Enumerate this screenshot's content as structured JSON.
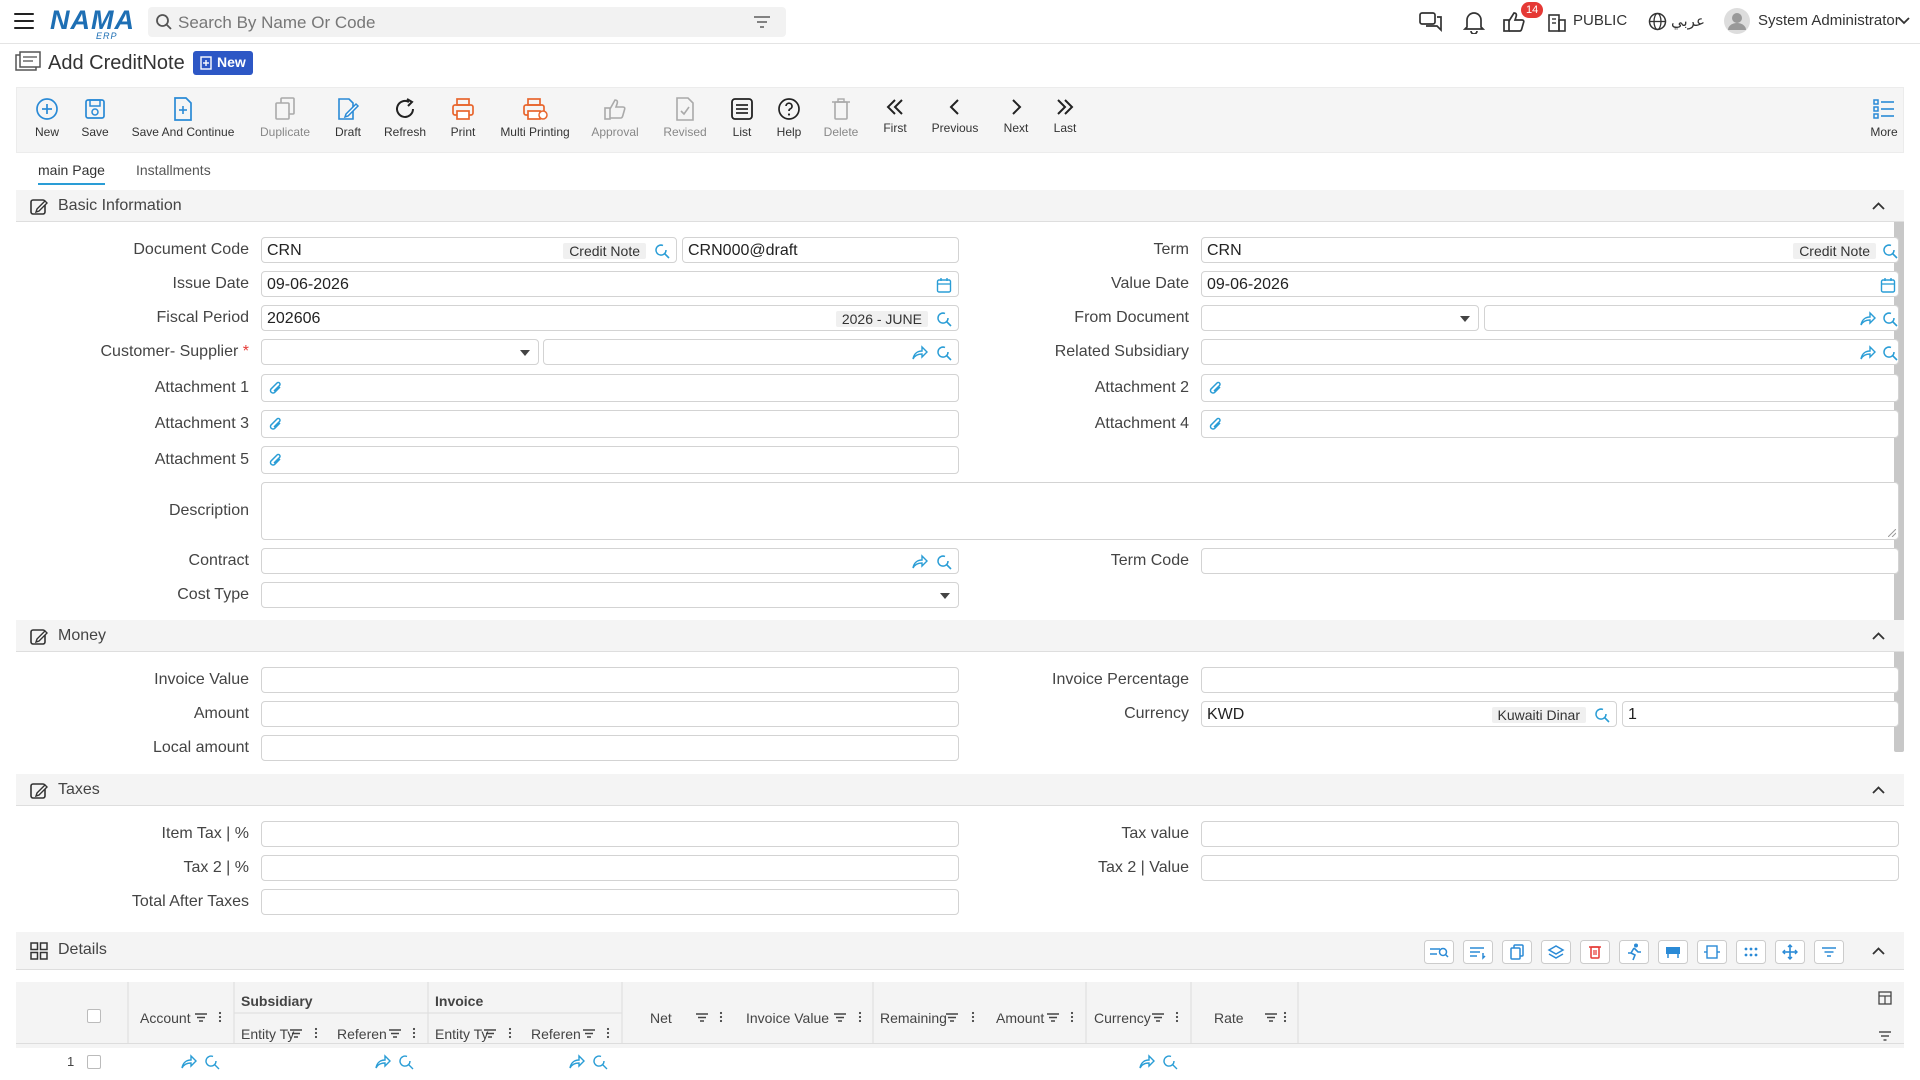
{
  "header": {
    "logo_text": "NAMA",
    "logo_sub": "ERP",
    "search_placeholder": "Search By Name Or Code",
    "notification_count": "14",
    "company": "PUBLIC",
    "language": "عربي",
    "user": "System Administrator"
  },
  "page": {
    "title": "Add CreditNote",
    "status_badge": "New"
  },
  "toolbar": {
    "new": "New",
    "save": "Save",
    "save_continue": "Save And Continue",
    "duplicate": "Duplicate",
    "draft": "Draft",
    "refresh": "Refresh",
    "print": "Print",
    "multi_printing": "Multi Printing",
    "approval": "Approval",
    "revised": "Revised",
    "list": "List",
    "help": "Help",
    "delete": "Delete",
    "first": "First",
    "previous": "Previous",
    "next": "Next",
    "last": "Last",
    "more": "More"
  },
  "tabs": {
    "main": "main Page",
    "installments": "Installments"
  },
  "sections": {
    "basic": "Basic Information",
    "money": "Money",
    "taxes": "Taxes",
    "details": "Details"
  },
  "basic": {
    "document_code_label": "Document Code",
    "document_code": "CRN",
    "document_code_tag": "Credit Note",
    "document_number": "CRN000@draft",
    "term_label": "Term",
    "term": "CRN",
    "term_tag": "Credit Note",
    "issue_date_label": "Issue Date",
    "issue_date": "09-06-2026",
    "value_date_label": "Value Date",
    "value_date": "09-06-2026",
    "fiscal_period_label": "Fiscal Period",
    "fiscal_period": "202606",
    "fiscal_period_tag": "2026 - JUNE",
    "from_document_label": "From Document",
    "customer_supplier_label": "Customer- Supplier",
    "required_mark": "*",
    "related_subsidiary_label": "Related Subsidiary",
    "attachment1_label": "Attachment 1",
    "attachment2_label": "Attachment 2",
    "attachment3_label": "Attachment 3",
    "attachment4_label": "Attachment 4",
    "attachment5_label": "Attachment 5",
    "description_label": "Description",
    "contract_label": "Contract",
    "term_code_label": "Term Code",
    "cost_type_label": "Cost Type"
  },
  "money": {
    "invoice_value_label": "Invoice Value",
    "invoice_percentage_label": "Invoice Percentage",
    "amount_label": "Amount",
    "currency_label": "Currency",
    "currency": "KWD",
    "currency_tag": "Kuwaiti Dinar",
    "rate": "1",
    "local_amount_label": "Local amount"
  },
  "taxes": {
    "item_tax_label": "Item Tax | %",
    "tax_value_label": "Tax value",
    "tax2_label": "Tax 2 | %",
    "tax2_value_label": "Tax 2 | Value",
    "total_after_taxes_label": "Total After Taxes"
  },
  "details_grid": {
    "group_subsidiary": "Subsidiary",
    "group_invoice": "Invoice",
    "columns": {
      "account": "Account",
      "sub_entity_type": "Entity Ty",
      "sub_reference": "Referen",
      "inv_entity_type": "Entity Ty",
      "inv_reference": "Referen",
      "net": "Net",
      "invoice_value": "Invoice Value",
      "remaining": "Remaining",
      "amount": "Amount",
      "currency": "Currency",
      "rate": "Rate"
    },
    "row_number": "1"
  }
}
